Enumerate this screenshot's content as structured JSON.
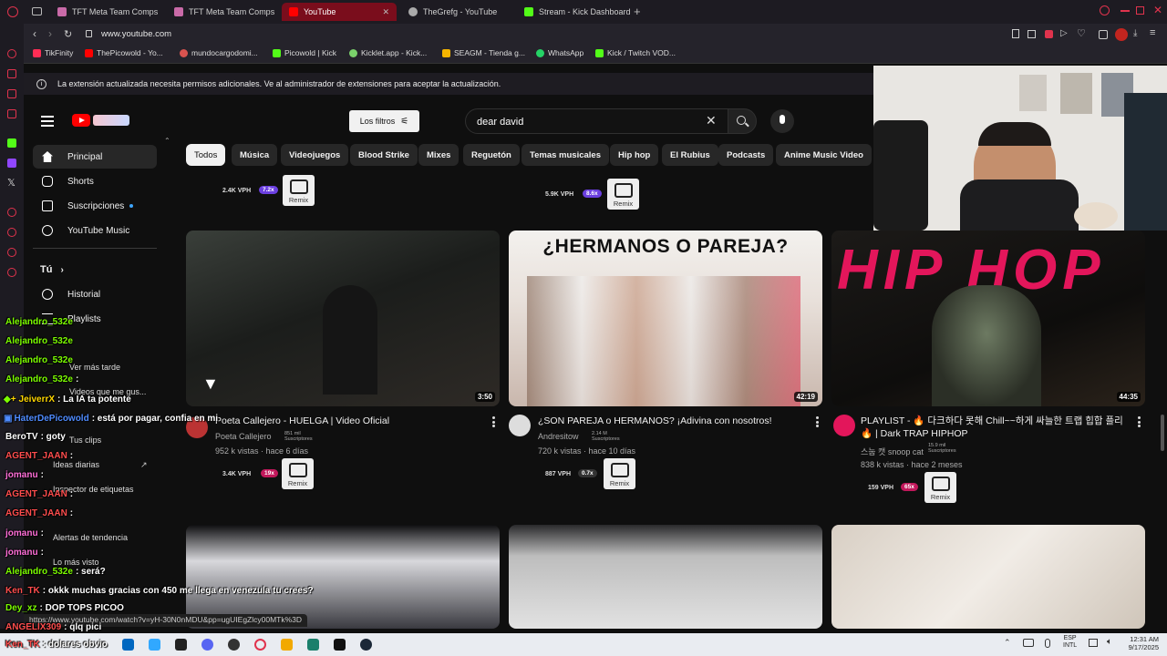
{
  "browser": {
    "tabs": [
      {
        "label": "TFT Meta Team Comps T",
        "icon_color": "#c96aa8"
      },
      {
        "label": "TFT Meta Team Comps T",
        "icon_color": "#c96aa8"
      },
      {
        "label": "YouTube",
        "icon_color": "#ff0000",
        "active": true
      },
      {
        "label": "TheGrefg - YouTube",
        "icon_color": "#aaaaaa"
      },
      {
        "label": "Stream - Kick Dashboard",
        "icon_color": "#53fc18"
      }
    ],
    "url": "www.youtube.com",
    "bookmarks": [
      {
        "label": "TikFinity",
        "color": "#ff2d55"
      },
      {
        "label": "ThePicowold - Yo...",
        "color": "#ff0000"
      },
      {
        "label": "mundocargodomi...",
        "color": "#d9534f"
      },
      {
        "label": "Picowold | Kick",
        "color": "#53fc18"
      },
      {
        "label": "Kicklet.app - Kick...",
        "color": "#7ad16b"
      },
      {
        "label": "SEAGM - Tienda g...",
        "color": "#f5b400"
      },
      {
        "label": "WhatsApp",
        "color": "#25d366"
      },
      {
        "label": "Kick / Twitch VOD...",
        "color": "#53fc18"
      }
    ],
    "status_url": "https://www.youtube.com/watch?v=yH-30N0nMDU&pp=ugUIEgZlcy00MTk%3D"
  },
  "notice": {
    "text": "La extensión actualizada necesita permisos adicionales. Ve al administrador de extensiones para aceptar la actualización."
  },
  "header": {
    "filters_label": "Los filtros",
    "search_value": "dear david"
  },
  "chips": [
    "Todos",
    "Música",
    "Videojuegos",
    "Blood Strike",
    "Mixes",
    "Reguetón",
    "Temas musicales",
    "Hip hop",
    "El Rubius",
    "Podcasts",
    "Anime Music Video"
  ],
  "sidebar": {
    "main": [
      {
        "label": "Principal",
        "icon": "home-icon"
      },
      {
        "label": "Shorts",
        "icon": "shorts-icon"
      },
      {
        "label": "Suscripciones",
        "icon": "subscriptions-icon"
      },
      {
        "label": "YouTube Music",
        "icon": "youtube-music-icon"
      }
    ],
    "you_label": "Tú",
    "you_items": [
      {
        "label": "Historial"
      },
      {
        "label": "Playlists"
      },
      {
        "label": "Ver más tarde"
      },
      {
        "label": "Videos que me gus..."
      },
      {
        "label": "Tus clips"
      },
      {
        "label": "Ideas diarias"
      },
      {
        "label": "Inspector de etiquetas"
      },
      {
        "label": "Alertas de tendencia"
      },
      {
        "label": "Lo más visto"
      }
    ]
  },
  "top_row_stats": [
    {
      "vph": "2.4K VPH",
      "mult": "7.2x",
      "mult_color": "#6b3fe0"
    },
    {
      "vph": "5.9K VPH",
      "mult": "8.6x",
      "mult_color": "#6b3fe0"
    }
  ],
  "remix_label": "Remix",
  "videos": [
    {
      "title": "Poeta Callejero - HUELGA | Video Oficial",
      "channel": "Poeta Callejero",
      "subs": "851 mil Suscriptores",
      "meta": "952 k vistas · hace 6 días",
      "duration": "3:50",
      "vph": "3.4K VPH",
      "mult": "19x",
      "mult_color": "#c2185b"
    },
    {
      "title": "¿SON PAREJA o HERMANOS? ¡Adivina con nosotros!",
      "channel": "Andresitow",
      "subs": "2.14 M Suscriptores",
      "meta": "720 k vistas · hace 10 días",
      "duration": "42:19",
      "thumb_text": "¿HERMANOS O PAREJA?",
      "vph": "887 VPH",
      "mult": "0.7x",
      "mult_color": "#333333"
    },
    {
      "title": "PLAYLIST - 🔥 다크하다 못해 Chill~~하게 싸늘한 트랩 힙합 플리 🔥 | Dark TRAP HIPHOP",
      "channel": "스눕 캣 snoop cat",
      "subs": "15.9 mil Suscriptores",
      "meta": "838 k vistas · hace 2 meses",
      "duration": "44:35",
      "thumb_text": "HIP HOP",
      "vph": "159 VPH",
      "mult": "65x",
      "mult_color": "#c2185b"
    }
  ],
  "chat": [
    {
      "user": "Alejandro_532e",
      "msg": "",
      "color": "#7cfc00"
    },
    {
      "user": "Alejandro_532e",
      "msg": "",
      "color": "#7cfc00"
    },
    {
      "user": "Alejandro_532e",
      "msg": "",
      "color": "#7cfc00"
    },
    {
      "user": "Alejandro_532e",
      "msg": ":",
      "color": "#7cfc00"
    },
    {
      "user": "JeiverrX",
      "msg": ": La IA ta potente",
      "color": "#ffd700"
    },
    {
      "user": "HaterDePicowold",
      "msg": ": está por pagar, confia en mi",
      "color": "#4f8cff"
    },
    {
      "user": "BeroTV",
      "msg": ": goty",
      "color": "#ffffff"
    },
    {
      "user": "AGENT_JAAN",
      "msg": ":",
      "color": "#ff4d4d"
    },
    {
      "user": "jomanu",
      "msg": ":",
      "color": "#ff6fd8"
    },
    {
      "user": "AGENT_JAAN",
      "msg": ":",
      "color": "#ff4d4d"
    },
    {
      "user": "AGENT_JAAN",
      "msg": ":",
      "color": "#ff4d4d"
    },
    {
      "user": "jomanu",
      "msg": ":",
      "color": "#ff6fd8"
    },
    {
      "user": "jomanu",
      "msg": ":",
      "color": "#ff6fd8"
    },
    {
      "user": "Alejandro_532e",
      "msg": ": será?",
      "color": "#7cfc00"
    },
    {
      "user": "Ken_TK",
      "msg": ": okkk muchas gracias con 450 me llega en venezula tu crees?",
      "color": "#ff4d4d"
    },
    {
      "user": "Dey_xz",
      "msg": ": DOP TOPS PICOO",
      "color": "#7cfc00"
    },
    {
      "user": "ANGELIX309",
      "msg": ": qlq pici",
      "color": "#ff4d4d"
    },
    {
      "user": "Ken_TK",
      "msg": ": dolares obvio",
      "color": "#ff4d4d"
    }
  ],
  "taskbar": {
    "lang": "ESP",
    "lang2": "INTL",
    "time": "12:31 AM",
    "date": "9/17/2025"
  }
}
